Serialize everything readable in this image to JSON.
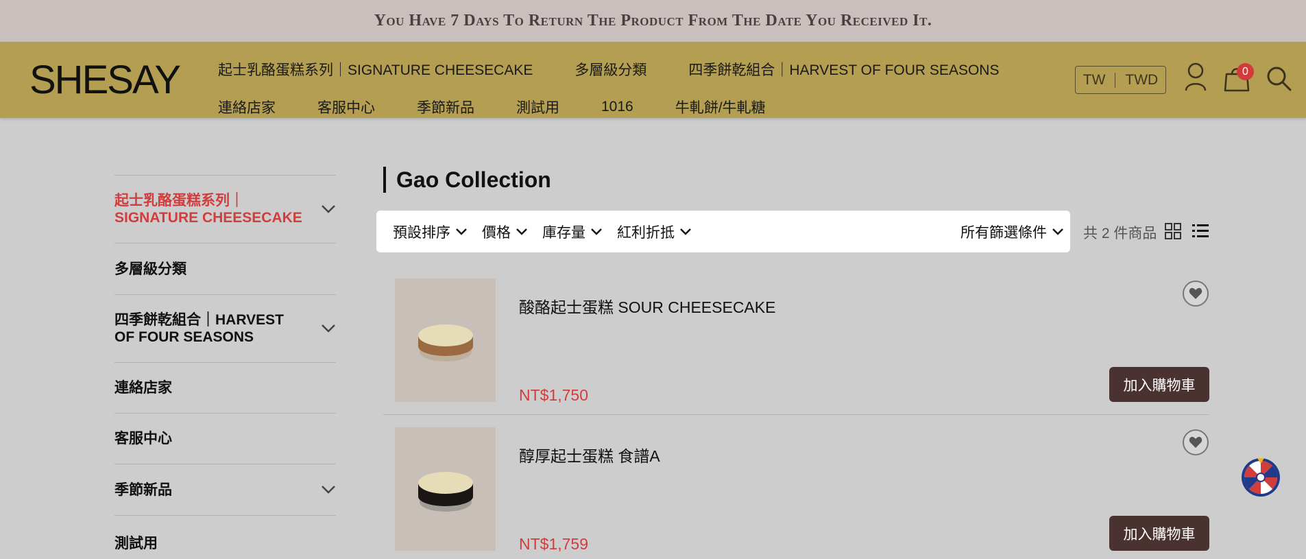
{
  "announcement": "You Have 7 Days To Return The Product From The Date You Received It.",
  "logo": "SHESAY",
  "nav": {
    "row1": [
      "起士乳酪蛋糕系列｜SIGNATURE CHEESECAKE",
      "多層級分類",
      "四季餅乾組合｜HARVEST OF FOUR SEASONS"
    ],
    "row2": [
      "連絡店家",
      "客服中心",
      "季節新品",
      "測試用",
      "1016",
      "牛軋餅/牛軋糖"
    ]
  },
  "header": {
    "lang": "TW",
    "currency": "TWD",
    "cart_count": "0"
  },
  "sidebar": {
    "items": [
      {
        "label": "起士乳酪蛋糕系列｜SIGNATURE CHEESECAKE",
        "expandable": true,
        "active": true
      },
      {
        "label": "多層級分類",
        "expandable": false,
        "active": false
      },
      {
        "label": "四季餅乾組合｜HARVEST OF FOUR SEASONS",
        "expandable": true,
        "active": false
      },
      {
        "label": "連絡店家",
        "expandable": false,
        "active": false
      },
      {
        "label": "客服中心",
        "expandable": false,
        "active": false
      },
      {
        "label": "季節新品",
        "expandable": true,
        "active": false
      },
      {
        "label": "測試用",
        "expandable": false,
        "active": false
      }
    ]
  },
  "main": {
    "title": "Gao Collection",
    "filters": {
      "sort": "預設排序",
      "price": "價格",
      "stock": "庫存量",
      "bonus": "紅利折抵",
      "all": "所有篩選條件"
    },
    "count_text": "共 2 件商品"
  },
  "products": [
    {
      "name": "酸酪起士蛋糕 SOUR CHEESECAKE",
      "price": "NT$1,750",
      "cart_label": "加入購物車",
      "base_color": "#9c6a40"
    },
    {
      "name": "醇厚起士蛋糕 食譜A",
      "price": "NT$1,759",
      "cart_label": "加入購物車",
      "base_color": "#1a1616"
    }
  ],
  "colors": {
    "header_bg": "#b39e52",
    "accent_red": "#d13d3d",
    "cart_button": "#4a3230",
    "announce_bg": "#c9c0be"
  }
}
